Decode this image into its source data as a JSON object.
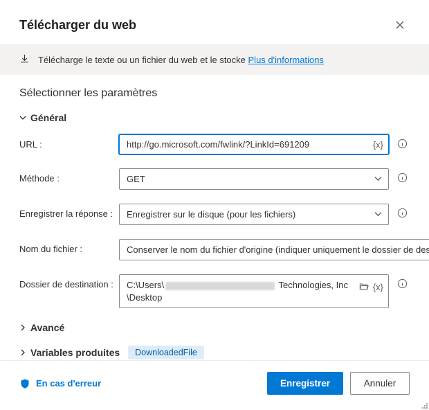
{
  "header": {
    "title": "Télécharger du web"
  },
  "info": {
    "text": "Télécharge le texte ou un fichier du web et le stocke ",
    "link": "Plus d'informations"
  },
  "section_title": "Sélectionner les paramètres",
  "groups": {
    "general": {
      "label": "Général",
      "expanded": true
    },
    "advanced": {
      "label": "Avancé",
      "expanded": false
    }
  },
  "fields": {
    "url": {
      "label": "URL :",
      "value": "http://go.microsoft.com/fwlink/?LinkId=691209",
      "var_token": "{x}"
    },
    "method": {
      "label": "Méthode :",
      "value": "GET"
    },
    "save_response": {
      "label": "Enregistrer la réponse :",
      "value": "Enregistrer sur le disque (pour les fichiers)"
    },
    "filename": {
      "label": "Nom du fichier :",
      "value": "Conserver le nom du fichier d'origine (indiquer uniquement le dossier de destination)"
    },
    "dest_folder": {
      "label": "Dossier de destination :",
      "value_prefix": "C:\\Users\\",
      "value_suffix": " Technologies, Inc\\Desktop",
      "var_token": "{x}"
    }
  },
  "variables_produced": {
    "label": "Variables produites",
    "pill": "DownloadedFile"
  },
  "footer": {
    "error": "En cas d'erreur",
    "save": "Enregistrer",
    "cancel": "Annuler"
  }
}
